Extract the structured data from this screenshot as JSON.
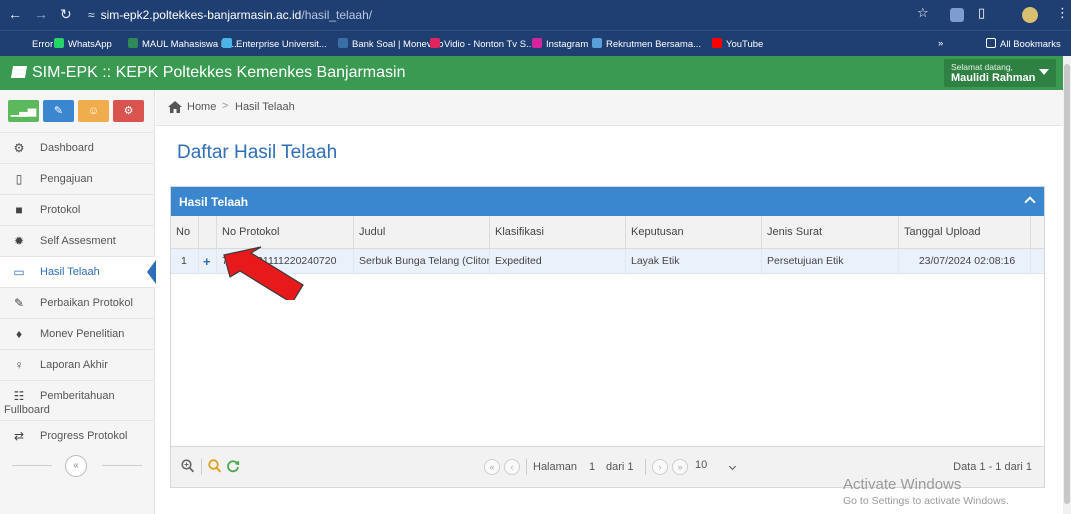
{
  "browser": {
    "url_host": "sim-epk2.poltekkes-banjarmasin.ac.id",
    "url_path": "/hasil_telaah/",
    "bookmarks": [
      {
        "label": "Error",
        "color": "#1f3f73"
      },
      {
        "label": "WhatsApp",
        "color": "#25d366"
      },
      {
        "label": "MAUL Mahasiswa M...",
        "color": "#2e8b57"
      },
      {
        "label": "Enterprise Universit...",
        "color": "#4ab3e8"
      },
      {
        "label": "Bank Soal | Monev.co",
        "color": "#3a6ea5"
      },
      {
        "label": "Vidio - Nonton Tv S...",
        "color": "#e0245e"
      },
      {
        "label": "Instagram",
        "color": "#d6249f"
      },
      {
        "label": "Rekrutmen Bersama...",
        "color": "#5aa0d8"
      },
      {
        "label": "YouTube",
        "color": "#ff0000"
      }
    ],
    "bookmarks_more": "»",
    "all_bookmarks": "All Bookmarks"
  },
  "header": {
    "title": "SIM-EPK :: KEPK Poltekkes Kemenkes Banjarmasin",
    "greeting": "Selamat datang,",
    "user_name": "Maulidi Rahman",
    "brand_color": "#3a9a52"
  },
  "sidebar": {
    "shortcuts": [
      {
        "icon": "chart-icon",
        "color": "#5cb85c"
      },
      {
        "icon": "pencil-icon",
        "color": "#3a86cf"
      },
      {
        "icon": "users-icon",
        "color": "#f0ad4e"
      },
      {
        "icon": "cogs-icon",
        "color": "#d9534f"
      }
    ],
    "items": [
      {
        "label": "Dashboard",
        "icon": "dashboard-icon",
        "glyph": "⚙"
      },
      {
        "label": "Pengajuan",
        "icon": "file-icon",
        "glyph": "▯"
      },
      {
        "label": "Protokol",
        "icon": "book-icon",
        "glyph": "■"
      },
      {
        "label": "Self Assesment",
        "icon": "certificate-icon",
        "glyph": "✹"
      },
      {
        "label": "Hasil Telaah",
        "icon": "desktop-icon",
        "glyph": "▭"
      },
      {
        "label": "Perbaikan Protokol",
        "icon": "edit-icon",
        "glyph": "✎"
      },
      {
        "label": "Monev Penelitian",
        "icon": "tint-icon",
        "glyph": "♦"
      },
      {
        "label": "Laporan Akhir",
        "icon": "lightbulb-icon",
        "glyph": "♀"
      },
      {
        "label": "Pemberitahuan",
        "label2": "Fullboard",
        "icon": "grid-icon",
        "glyph": "☷"
      },
      {
        "label": "Progress Protokol",
        "icon": "exchange-icon",
        "glyph": "⇄"
      }
    ],
    "active_index": 4,
    "collapse": "«"
  },
  "breadcrumb": {
    "home": "Home",
    "separator": ">",
    "current": "Hasil Telaah"
  },
  "page_title": "Daftar Hasil Telaah",
  "panel": {
    "title": "Hasil Telaah",
    "columns": [
      "No",
      "No Protokol",
      "Judul",
      "Klasifikasi",
      "Keputusan",
      "Jenis Surat",
      "Tanggal Upload"
    ],
    "rows": [
      {
        "no": "1",
        "expand": "+",
        "no_protokol": "72163721111220240720",
        "judul": "Serbuk Bunga Telang (Clitori",
        "klasifikasi": "Expedited",
        "keputusan": "Layak Etik",
        "jenis_surat": "Persetujuan Etik",
        "tanggal_upload": "23/07/2024 02:08:16"
      }
    ],
    "pager": {
      "halaman": "Halaman",
      "page": "1",
      "dari": "dari 1",
      "page_size": "10",
      "info": "Data 1 - 1 dari 1"
    }
  },
  "watermark": {
    "line1": "Activate Windows",
    "line2": "Go to Settings to activate Windows."
  }
}
